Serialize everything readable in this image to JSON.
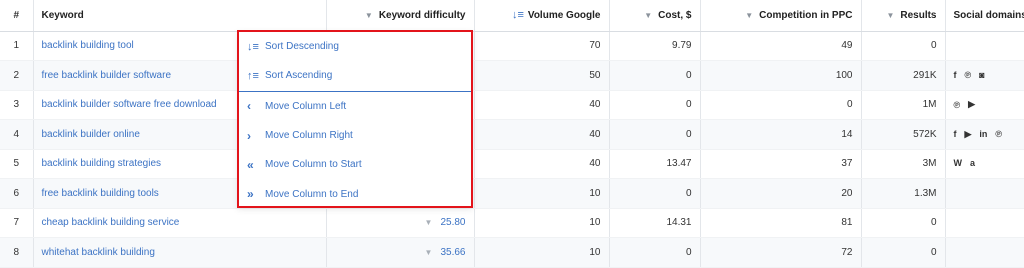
{
  "columns": {
    "index": "#",
    "keyword": "Keyword",
    "kd": "Keyword difficulty",
    "volume": "Volume Google",
    "cost": "Cost, $",
    "competition": "Competition in PPC",
    "results": "Results",
    "social": "Social domains"
  },
  "rows": [
    {
      "n": "1",
      "keyword": "backlink building tool",
      "kd": "",
      "volume": "70",
      "cost": "9.79",
      "competition": "49",
      "results": "0",
      "social": []
    },
    {
      "n": "2",
      "keyword": "free backlink builder software",
      "kd": "",
      "volume": "50",
      "cost": "0",
      "competition": "100",
      "results": "291K",
      "social": [
        "facebook-icon",
        "pinterest-icon",
        "instagram-icon"
      ]
    },
    {
      "n": "3",
      "keyword": "backlink builder software free download",
      "kd": "",
      "volume": "40",
      "cost": "0",
      "competition": "0",
      "results": "1M",
      "social": [
        "pinterest-icon",
        "youtube-icon"
      ]
    },
    {
      "n": "4",
      "keyword": "backlink builder online",
      "kd": "",
      "volume": "40",
      "cost": "0",
      "competition": "14",
      "results": "572K",
      "social": [
        "facebook-icon",
        "youtube-icon",
        "linkedin-icon",
        "pinterest-icon"
      ]
    },
    {
      "n": "5",
      "keyword": "backlink building strategies",
      "kd": "",
      "volume": "40",
      "cost": "13.47",
      "competition": "37",
      "results": "3M",
      "social": [
        "wikipedia-icon",
        "amazon-icon"
      ]
    },
    {
      "n": "6",
      "keyword": "free backlink building tools",
      "kd": "",
      "volume": "10",
      "cost": "0",
      "competition": "20",
      "results": "1.3M",
      "social": []
    },
    {
      "n": "7",
      "keyword": "cheap backlink building service",
      "kd": "25.80",
      "volume": "10",
      "cost": "14.31",
      "competition": "81",
      "results": "0",
      "social": []
    },
    {
      "n": "8",
      "keyword": "whitehat backlink building",
      "kd": "35.66",
      "volume": "10",
      "cost": "0",
      "competition": "72",
      "results": "0",
      "social": []
    }
  ],
  "social_glyphs": {
    "facebook-icon": "f",
    "pinterest-icon": "℗",
    "instagram-icon": "◙",
    "youtube-icon": "▶",
    "linkedin-icon": "in",
    "wikipedia-icon": "W",
    "amazon-icon": "a"
  },
  "menu": {
    "sort_desc": "Sort Descending",
    "sort_asc": "Sort Ascending",
    "move_left": "Move Column Left",
    "move_right": "Move Column Right",
    "move_start": "Move Column to Start",
    "move_end": "Move Column to End",
    "icons": {
      "sort_desc": "↓≡",
      "sort_asc": "↑≡",
      "move_left": "‹",
      "move_right": "›",
      "move_start": "«",
      "move_end": "»"
    }
  },
  "colors": {
    "link": "#3c73c4",
    "menu_border": "#e3141b",
    "row_alt": "#f7f9fb"
  }
}
